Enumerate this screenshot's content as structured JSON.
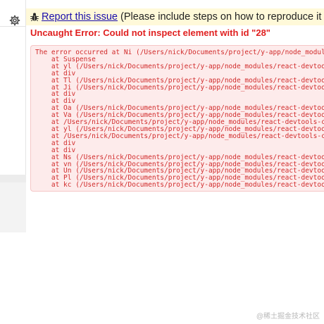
{
  "banner": {
    "icon": "bug-icon",
    "link_text": "Report this issue",
    "note": "(Please include steps on how to reproduce it and the cor"
  },
  "error": {
    "title": "Uncaught Error: Could not inspect element with id \"28\"",
    "stack_lines": [
      "The error occurred at Ni (/Users/nick/Documents/project/y-app/node_modules/react-d",
      "    at Suspense",
      "    at yl (/Users/nick/Documents/project/y-app/node_modules/react-devtools-core/di",
      "    at div",
      "    at Tl (/Users/nick/Documents/project/y-app/node_modules/react-devtools-core/di",
      "    at Ji (/Users/nick/Documents/project/y-app/node_modules/react-devtools-core/di",
      "    at div",
      "    at div",
      "    at Oa (/Users/nick/Documents/project/y-app/node_modules/react-devtools-core/di",
      "    at Va (/Users/nick/Documents/project/y-app/node_modules/react-devtools-core/di",
      "    at /Users/nick/Documents/project/y-app/node_modules/react-devtools-core/dist/s",
      "    at yl (/Users/nick/Documents/project/y-app/node_modules/react-devtools-core/di",
      "    at /Users/nick/Documents/project/y-app/node_modules/react-devtools-core/dist/s",
      "    at div",
      "    at div",
      "    at Ns (/Users/nick/Documents/project/y-app/node_modules/react-devtools-core/di",
      "    at vn (/Users/nick/Documents/project/y-app/node_modules/react-devtools-core/di",
      "    at Un (/Users/nick/Documents/project/y-app/node_modules/react-devtools-core/di",
      "    at Pl (/Users/nick/Documents/project/y-app/node_modules/react-devtools-core/di",
      "    at kc (/Users/nick/Documents/project/y-app/node_modules/react-devtools-core/di"
    ]
  },
  "toolbar": {
    "settings_icon": "gear-icon"
  },
  "watermark": "@稀土掘金技术社区",
  "colors": {
    "banner_bg": "#fff9d9",
    "error_red": "#e02020",
    "stack_bg": "#fdebeb",
    "link_blue": "#1a0dab"
  }
}
